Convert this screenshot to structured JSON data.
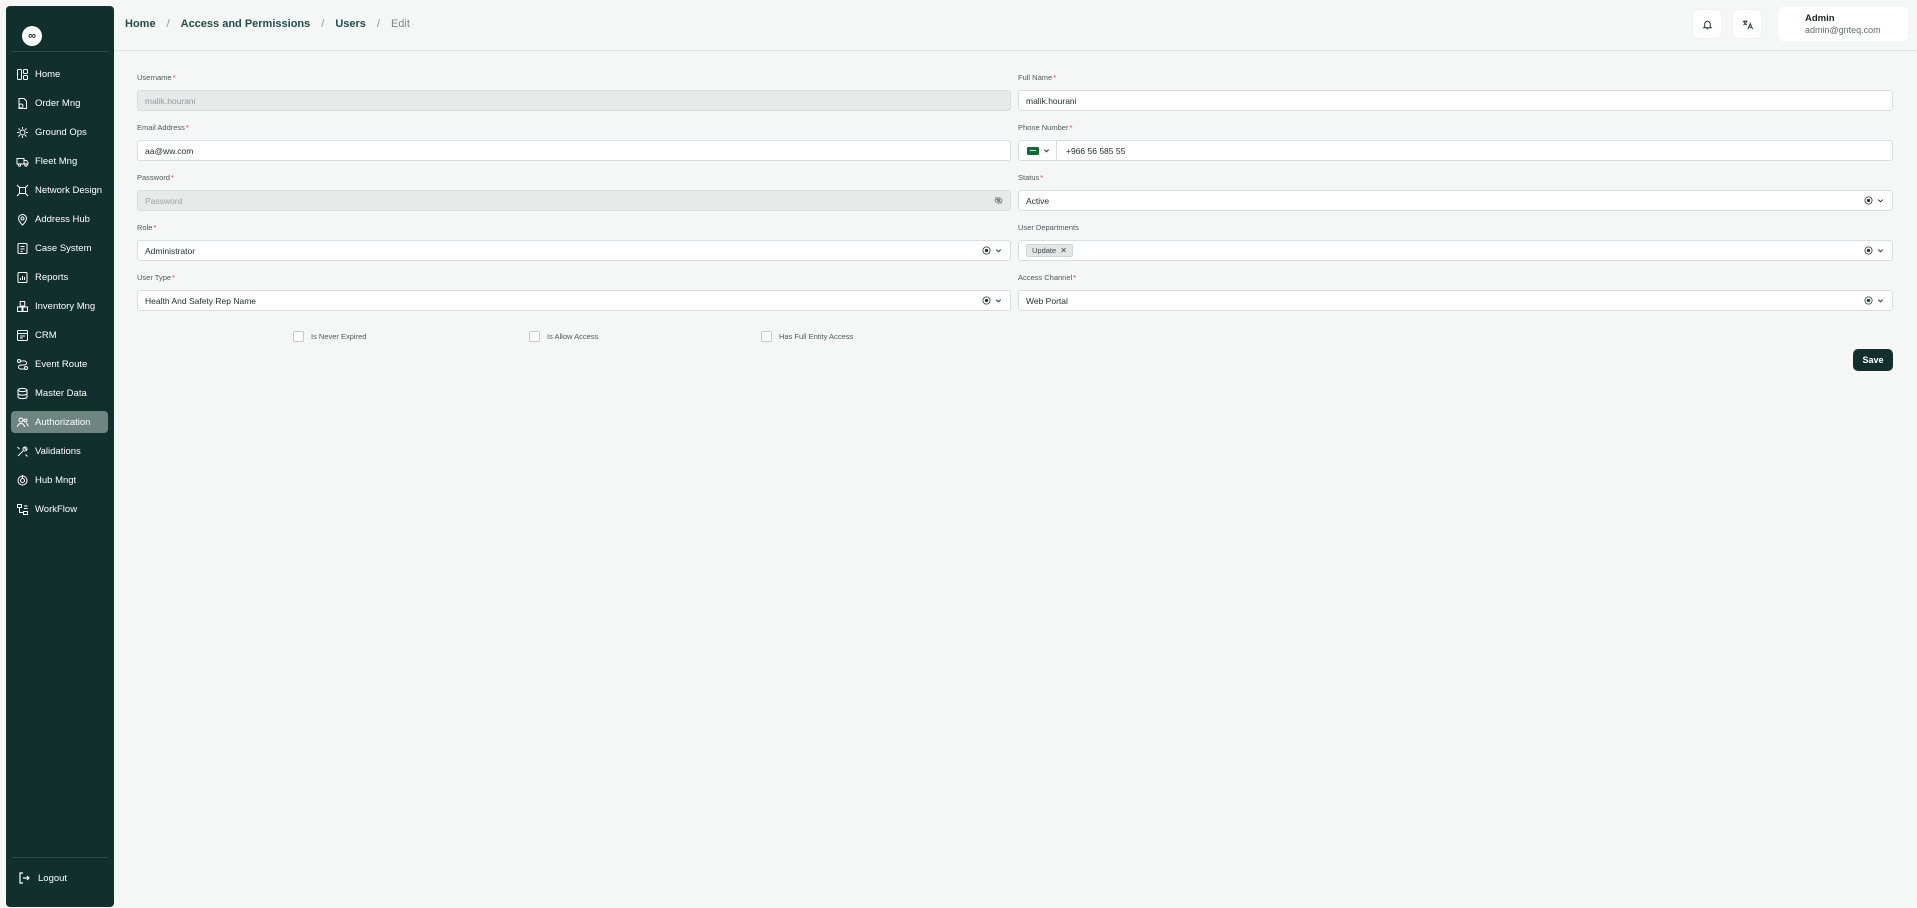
{
  "sidebar": {
    "logo": "∞",
    "items": [
      {
        "label": "Home",
        "icon": "home-icon"
      },
      {
        "label": "Order Mng",
        "icon": "order-icon"
      },
      {
        "label": "Ground Ops",
        "icon": "ground-ops-icon"
      },
      {
        "label": "Fleet Mng",
        "icon": "truck-icon"
      },
      {
        "label": "Network Design",
        "icon": "network-icon"
      },
      {
        "label": "Address Hub",
        "icon": "location-icon"
      },
      {
        "label": "Case System",
        "icon": "case-icon"
      },
      {
        "label": "Reports",
        "icon": "reports-icon"
      },
      {
        "label": "Inventory Mng",
        "icon": "inventory-icon"
      },
      {
        "label": "CRM",
        "icon": "crm-icon"
      },
      {
        "label": "Event Route",
        "icon": "route-icon"
      },
      {
        "label": "Master Data",
        "icon": "database-icon"
      },
      {
        "label": "Authorization",
        "icon": "users-icon",
        "active": true
      },
      {
        "label": "Validations",
        "icon": "tools-icon"
      },
      {
        "label": "Hub Mngt",
        "icon": "hub-icon"
      },
      {
        "label": "WorkFlow",
        "icon": "workflow-icon"
      }
    ],
    "logout": "Logout"
  },
  "header": {
    "breadcrumb": [
      "Home",
      "Access and Permissions",
      "Users",
      "Edit"
    ],
    "user": {
      "name": "Admin",
      "email": "admin@gnteq.com"
    }
  },
  "form": {
    "username": {
      "label": "Username",
      "value": "malik.hourani"
    },
    "full_name": {
      "label": "Full Name",
      "value": "malik.hourani"
    },
    "email": {
      "label": "Email Address",
      "value": "aa@ww.com"
    },
    "phone": {
      "label": "Phone Number",
      "value": "+966 56 585 55",
      "country": "SA"
    },
    "password": {
      "label": "Password",
      "placeholder": "Password"
    },
    "status": {
      "label": "Status",
      "value": "Active"
    },
    "role": {
      "label": "Role",
      "value": "Administrator"
    },
    "departments": {
      "label": "User Departments",
      "chips": [
        "Update"
      ]
    },
    "user_type": {
      "label": "User Type",
      "value": "Health And Safety Rep Name"
    },
    "access_channel": {
      "label": "Access Channel",
      "value": "Web Portal"
    },
    "checkboxes": {
      "never_expired": "Is Never Expired",
      "allow_access": "Is Allow Access",
      "full_entity": "Has Full Entity Access"
    },
    "required_mark": "*",
    "save_label": "Save"
  },
  "colors": {
    "sidebar_bg": "#11302d",
    "accent": "#11302d",
    "active_item": "#6e8582",
    "required": "#d63c3c"
  }
}
